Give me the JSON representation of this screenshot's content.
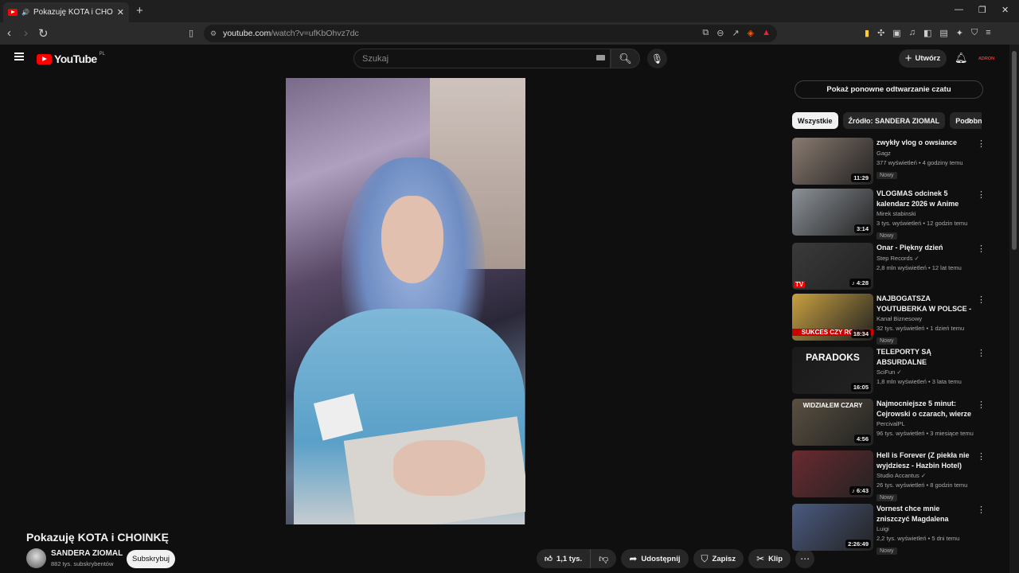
{
  "browser": {
    "tab_title": "Pokazuję KOTA i CHOINKĘ - Y",
    "tab_close": "✕",
    "new_tab": "+",
    "url_host": "youtube.com",
    "url_path": "/watch?v=ufKbOhvz7dc"
  },
  "header": {
    "logo_text": "YouTube",
    "country": "PL",
    "search_placeholder": "Szukaj",
    "create_label": "Utwórz",
    "avatar_text": "ADRON"
  },
  "video": {
    "title": "Pokazuję KOTA i CHOINKĘ",
    "channel": "SANDERA ZIOMAL",
    "subscribers": "882 tys. subskrybentów",
    "subscribe_label": "Subskrybuj",
    "likes": "1,1 tys.",
    "share_label": "Udostępnij",
    "save_label": "Zapisz",
    "clip_label": "Klip"
  },
  "sidebar": {
    "chat_replay_label": "Pokaż ponowne odtwarzanie czatu",
    "chips": [
      "Wszystkie",
      "Źródło: SANDERA ZIOMAL",
      "Podobne"
    ],
    "recommendations": [
      {
        "title": "zwykły vlog o owsiance",
        "channel": "Gagz",
        "meta": "377 wyświetleń • 4 godziny temu",
        "badge": "Nowy",
        "duration": "11:29",
        "color": "#8a7a70"
      },
      {
        "title": "VLOGMAS odcinek 5 kalendarz 2026 w Anime One Piece ...",
        "channel": "Mirek stabinski",
        "meta": "3 tys. wyświetleń • 12 godzin temu",
        "badge": "Nowy",
        "duration": "3:14",
        "color": "#8c9298"
      },
      {
        "title": "Onar - Piękny dzień",
        "channel": "Step Records ✓",
        "meta": "2,8 mln wyświetleń • 12 lat temu",
        "badge": "",
        "duration": "♪ 4:28",
        "color": "#3a3a3a",
        "tv": "TV"
      },
      {
        "title": "NAJBOGATSZA YOUTUBERKA W POLSCE - JAK POWSTAŁA ...",
        "channel": "Kanał Biznesowy",
        "meta": "32 tys. wyświetleń • 1 dzień temu",
        "badge": "Nowy",
        "duration": "18:34",
        "color": "#c8a040",
        "overlay": "SUKCES CZY RODZI"
      },
      {
        "title": "TELEPORTY SĄ ABSURDALNE",
        "channel": "SciFun ✓",
        "meta": "1,8 mln wyświetleń • 3 lata temu",
        "badge": "",
        "duration": "16:05",
        "color": "#1a1a1a",
        "overlay": "PARADOKS"
      },
      {
        "title": "Najmocniejsze 5 minut: Cejrowski o czarach, wierze i ...",
        "channel": "PercivalPL",
        "meta": "96 tys. wyświetleń • 3 miesiące temu",
        "badge": "",
        "duration": "4:56",
        "color": "#5a5040",
        "overlay": "WIDZIAŁEM CZARY"
      },
      {
        "title": "Hell is Forever (Z piekła nie wyjdziesz - Hazbin Hotel) Jan ...",
        "channel": "Studio Accantus ✓",
        "meta": "26 tys. wyświetleń • 8 godzin temu",
        "badge": "Nowy",
        "duration": "♪ 6:43",
        "color": "#6a2a30"
      },
      {
        "title": "Vornest chce mnie zniszczyć Magdalena Kłosowska nocny ...",
        "channel": "Luigi",
        "meta": "2,2 tys. wyświetleń • 5 dni temu",
        "badge": "Nowy",
        "duration": "2:26:49",
        "color": "#4a5a80"
      }
    ]
  }
}
